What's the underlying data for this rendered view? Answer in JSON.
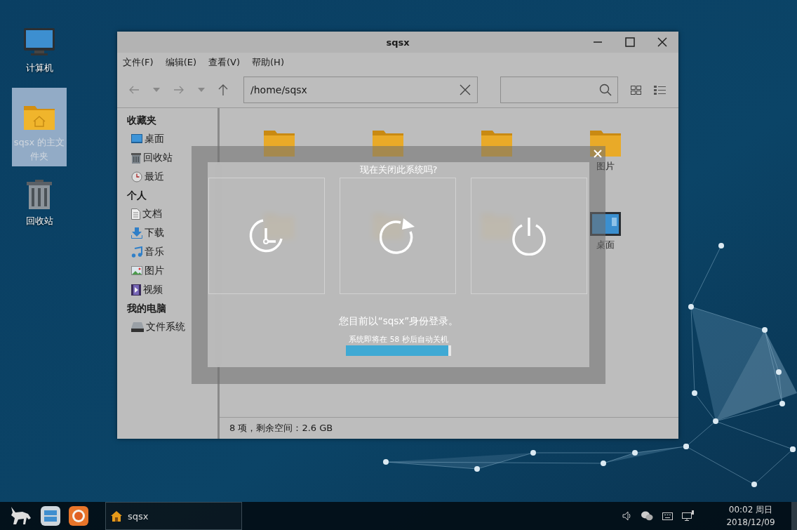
{
  "desktop_icons": [
    {
      "kind": "computer",
      "label": "计算机",
      "selected": false
    },
    {
      "kind": "home-folder",
      "label": "sqsx 的主文件夹",
      "selected": true
    },
    {
      "kind": "trash",
      "label": "回收站",
      "selected": false
    }
  ],
  "window": {
    "title": "sqsx",
    "menu": [
      "文件(F)",
      "编辑(E)",
      "查看(V)",
      "帮助(H)"
    ],
    "path": "/home/sqsx",
    "sidebar": [
      {
        "heading": "收藏夹",
        "items": [
          {
            "kind": "desktop",
            "label": "桌面"
          },
          {
            "kind": "trash",
            "label": "回收站"
          },
          {
            "kind": "recent",
            "label": "最近"
          }
        ]
      },
      {
        "heading": "个人",
        "items": [
          {
            "kind": "document",
            "label": "文档"
          },
          {
            "kind": "download",
            "label": "下载"
          },
          {
            "kind": "music",
            "label": "音乐"
          },
          {
            "kind": "picture",
            "label": "图片"
          },
          {
            "kind": "video",
            "label": "视频"
          }
        ]
      },
      {
        "heading": "我的电脑",
        "items": [
          {
            "kind": "drive",
            "label": "文件系统"
          }
        ]
      }
    ],
    "files": [
      {
        "kind": "folder"
      },
      {
        "kind": "folder"
      },
      {
        "kind": "folder"
      },
      {
        "kind": "folder",
        "label": "图片"
      },
      {
        "kind": "folder"
      },
      {
        "kind": "folder"
      },
      {
        "kind": "folder"
      },
      {
        "kind": "desktop",
        "label": "桌面"
      }
    ],
    "status": "8 项，剩余空间：2.6 GB"
  },
  "dialog": {
    "question": "现在关闭此系统吗?",
    "options": [
      {
        "kind": "suspend"
      },
      {
        "kind": "restart"
      },
      {
        "kind": "shutdown"
      }
    ],
    "message": "您目前以“sqsx”身份登录。",
    "countdown": "系统即将在 58 秒后自动关机",
    "level": 0.97
  },
  "taskbar": {
    "launchers": [
      {
        "kind": "logo"
      },
      {
        "kind": "files"
      },
      {
        "kind": "browser"
      }
    ],
    "tasks": [
      {
        "label": "sqsx",
        "selected": true
      }
    ],
    "tray": [
      {
        "kind": "volume"
      },
      {
        "kind": "chat"
      },
      {
        "kind": "keyboard"
      },
      {
        "kind": "network"
      }
    ],
    "time": "00:02 周日",
    "date": "2018/12/09"
  }
}
